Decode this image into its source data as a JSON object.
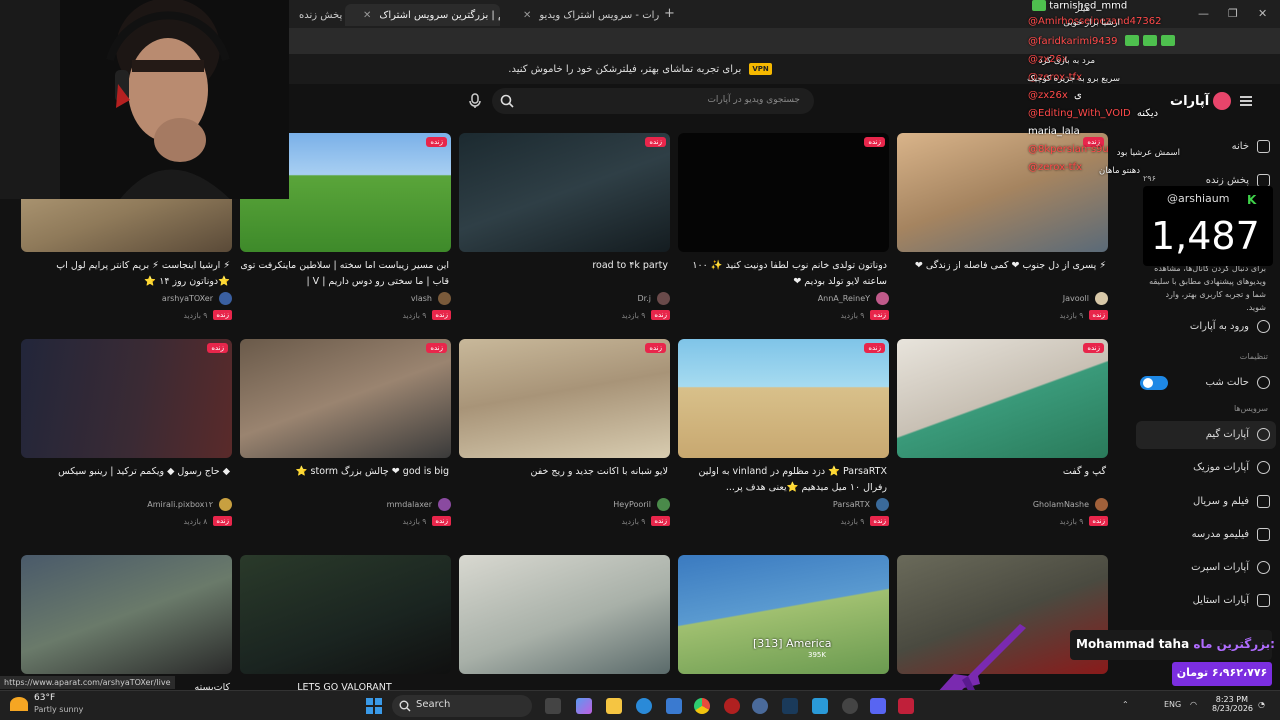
{
  "browser": {
    "tabs": [
      {
        "label": "پخش زنده",
        "active": false
      },
      {
        "label": "آپارات گیم | بزرگترین سرویس اشتراک",
        "active": true
      },
      {
        "label": "آپارات - سرویس اشتراک ویدیو",
        "active": false
      }
    ]
  },
  "notice": {
    "vpn": "VPN",
    "text": "برای تجربه تماشای بهتر، فیلترشکن خود را خاموش کنید."
  },
  "header": {
    "logo": "آپارات",
    "search_placeholder": "جستجوی ویدیو در آپارات"
  },
  "sidebar": {
    "home": "خانه",
    "live": "پخش زنده",
    "live_count": "۲۹۶",
    "desc": "برای دنبال کردن کانال‌ها، مشاهده ویدیوهای پیشنهادی مطابق با سلیقه شما و تجربه کاربری بهتر، وارد شوید.",
    "login": "ورود به آپارات",
    "settings_label": "تنظیمات",
    "dark_mode": "حالت شب",
    "services_label": "سرویس‌ها",
    "services": [
      "آپارات گیم",
      "آپارات موزیک",
      "فیلم و سریال",
      "فیلیمو مدرسه",
      "آپارات اسپرت",
      "آپارات استایل"
    ]
  },
  "cards": [
    {
      "title": "⚡ ارشیا اینجاست ⚡ بریم کانتر پرایم لول اپ ⭐دوناتون روز ۱۴ ⭐",
      "channel": "arshyaTOXer",
      "stats": "۹ بازدید",
      "live": "زنده"
    },
    {
      "title": "این مسیر زیباست اما سخته | سلاطین ماینکرفت توی قاب | ما سختی رو دوس داریم | V |",
      "channel": "vlash",
      "stats": "۹ بازدید",
      "live": "زنده"
    },
    {
      "title": "road to ۴k party",
      "channel": "Dr.j",
      "stats": "۹ بازدید",
      "live": "زنده"
    },
    {
      "title": "دوناتون تولدی خانم نوب لطفا دونیت کنید ✨ ۱۰۰ ساعته لایو تولد بودیم ❤",
      "channel": "AnnA_ReineY",
      "stats": "۹ بازدید",
      "live": "زنده"
    },
    {
      "title": "⚡ پسری از دل جنوب ❤ کمی فاصله از زندگی ❤",
      "channel": "Javooll",
      "stats": "۹ بازدید",
      "live": "زنده"
    },
    {
      "title": "◆ حاج رسول ◆ ویکمم ترکید | رینبو سیکس",
      "channel": "Amirali.pixbox۱۲",
      "stats": "۸ بازدید",
      "live": "زنده"
    },
    {
      "title": "god is big ❤ چالش بزرگ storm ⭐",
      "channel": "mmdalaxer",
      "stats": "۹ بازدید",
      "live": "زنده"
    },
    {
      "title": "لایو شبانه با اکانت جدید و ریج خفن",
      "channel": "HeyPooril",
      "stats": "۹ بازدید",
      "live": "زنده"
    },
    {
      "title": "ParsaRTX ⭐ دزد مظلوم در vinland به اولین رفرال ۱۰ میل میدهیم ⭐یعنی هدف پر...",
      "channel": "ParsaRTX",
      "stats": "۹ بازدید",
      "live": "زنده"
    },
    {
      "title": "گپ و گفت",
      "channel": "GholamNashe",
      "stats": "۹ بازدید",
      "live": "زنده"
    }
  ],
  "row3_titles": [
    "کات‌بسته",
    "LETS GO VALORANT"
  ],
  "row3_labels": {
    "map": "[313] America",
    "map_sub": "395K"
  },
  "chat": {
    "lines": [
      {
        "user": "tarnished_mmd",
        "msg": "هیلر"
      },
      {
        "user": "@Amirhosseinezand47362",
        "msg": "ارشیا برار خوبی"
      },
      {
        "user": "@faridkarimi9439",
        "msg": ""
      },
      {
        "user": "@zx26x",
        "msg": "مرد به بازی کرد"
      },
      {
        "user": "@zerox-tfx",
        "msg": "سریع برو به جزیره کوچیک"
      },
      {
        "user": "@zx26x",
        "msg": "ی"
      },
      {
        "user": "@Editing_With_VOID",
        "msg": "دیکنه"
      },
      {
        "user": "maria_lala",
        "msg": ""
      },
      {
        "user": "@8kpersian-s9u",
        "msg": "اسمش عرشیا بود"
      },
      {
        "user": "@zerox-tfx",
        "msg": "دهنتو ماهان"
      }
    ]
  },
  "viewer": {
    "name": "@arshiaum",
    "count": "1,487"
  },
  "donation": {
    "label": "بزرگترین ماه:",
    "name": "Mohammad taha",
    "amount": "۶،۹۶۲،۷۷۶ تومان"
  },
  "statusbar": {
    "url": "https://www.aparat.com/arshyaTOXer/live"
  },
  "taskbar": {
    "temp": "63°F",
    "weather": "Partly sunny",
    "search": "Search",
    "lang": "ENG",
    "time": "8:23 PM",
    "date": "8/23/2026"
  }
}
